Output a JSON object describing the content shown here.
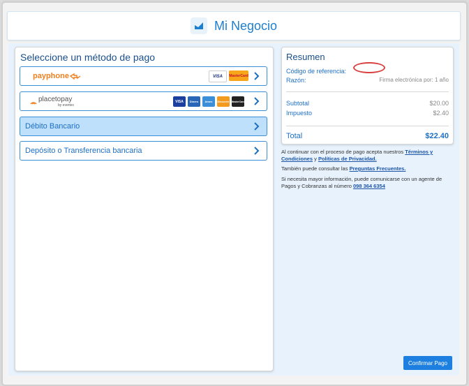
{
  "header": {
    "brand": "Mi Negocio"
  },
  "payment": {
    "title": "Seleccione un método de pago",
    "methods": [
      {
        "label": "payphone",
        "cards": [
          "VISA",
          "MasterCard"
        ]
      },
      {
        "label": "placetopay",
        "sub": "by evertec",
        "cards": [
          "VISA",
          "Diners",
          "Amex",
          "Discover",
          "MasterCard"
        ]
      },
      {
        "label": "Débito Bancario"
      },
      {
        "label": "Depósito o Transferencia bancaria"
      }
    ]
  },
  "summary": {
    "title": "Resumen",
    "ref_label": "Código de referencia:",
    "ref_value": "",
    "reason_label": "Razón:",
    "reason_value": "Firma electrónica por: 1 año",
    "subtotal_label": "Subtotal",
    "subtotal_value": "$20.00",
    "tax_label": "Impuesto",
    "tax_value": "$2.40",
    "total_label": "Total",
    "total_value": "$22.40"
  },
  "notes": {
    "terms_prefix": "Al continuar con el proceso de pago acepta nuestros ",
    "terms_link": "Términos y Condiciones",
    "terms_mid": " y ",
    "privacy_link": "Políticas de Privacidad.",
    "faq_prefix": "También puede consultar las ",
    "faq_link": "Preguntas Frecuentes.",
    "info_prefix": "Si necesita mayor información, puede comunicarse con un agente de Pagos y Cobranzas al número ",
    "phone_link": "098 364 6354"
  },
  "confirm_label": "Confirmar Pago",
  "colors": {
    "accent": "#1d7fd0",
    "selected": "#bfe0fb",
    "highlight": "#d84040"
  }
}
